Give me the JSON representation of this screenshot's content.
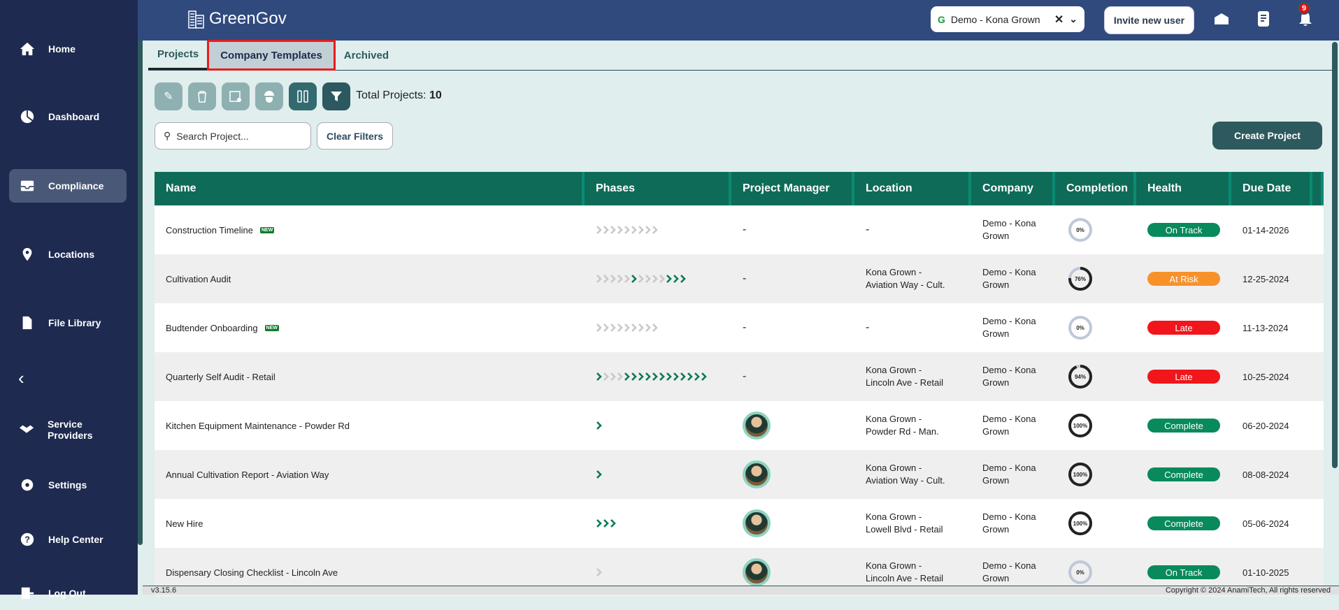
{
  "sidebar": {
    "items": [
      {
        "label": "Home",
        "icon": "home-icon"
      },
      {
        "label": "Dashboard",
        "icon": "pie-chart-icon"
      },
      {
        "label": "Compliance",
        "icon": "inbox-icon",
        "active": true
      },
      {
        "label": "Locations",
        "icon": "location-pin-icon"
      },
      {
        "label": "File Library",
        "icon": "file-icon"
      },
      {
        "label": "Service Providers",
        "icon": "handshake-icon"
      },
      {
        "label": "Settings",
        "icon": "gear-icon"
      },
      {
        "label": "Help Center",
        "icon": "help-icon"
      },
      {
        "label": "Log Out",
        "icon": "logout-icon"
      }
    ]
  },
  "header": {
    "app_name": "GreenGov",
    "company": "Demo - Kona Grown",
    "invite_label": "Invite new user",
    "notification_count": "9"
  },
  "tabs": [
    {
      "label": "Projects"
    },
    {
      "label": "Company Templates"
    },
    {
      "label": "Archived"
    }
  ],
  "toolbar": {
    "total_label": "Total Projects:",
    "total_value": "10"
  },
  "search": {
    "placeholder": "Search Project..."
  },
  "clear_filters": "Clear Filters",
  "create_project": "Create Project",
  "columns": [
    "Name",
    "Phases",
    "Project Manager",
    "Location",
    "Company",
    "Completion",
    "Health",
    "Due Date"
  ],
  "colors": {
    "done": "#0a7a55",
    "pending": "#c8c8c8",
    "On Track": "#088a5c",
    "Complete": "#088a5c",
    "At Risk": "#f7922b",
    "Late": "#f0161b"
  },
  "rows": [
    {
      "name": "Construction Timeline",
      "new": "NEW",
      "phases": "000000000",
      "manager": "-",
      "location": "-",
      "company": "Demo - Kona Grown",
      "completion": 0,
      "completion_label": "0%",
      "health": "On Track",
      "due": "01-14-2026"
    },
    {
      "name": "Cultivation Audit",
      "new": "",
      "phases": "0000010000111",
      "manager": "-",
      "location": "Kona Grown - Aviation Way - Cult.",
      "company": "Demo - Kona Grown",
      "completion": 76,
      "completion_label": "76%",
      "health": "At Risk",
      "due": "12-25-2024"
    },
    {
      "name": "Budtender Onboarding",
      "new": "NEW",
      "phases": "000000000",
      "manager": "-",
      "location": "-",
      "company": "Demo - Kona Grown",
      "completion": 0,
      "completion_label": "0%",
      "health": "Late",
      "due": "11-13-2024"
    },
    {
      "name": "Quarterly Self Audit - Retail",
      "new": "",
      "phases": "1000111111111111",
      "manager": "-",
      "location": "Kona Grown - Lincoln Ave - Retail",
      "company": "Demo - Kona Grown",
      "completion": 94,
      "completion_label": "94%",
      "health": "Late",
      "due": "10-25-2024"
    },
    {
      "name": "Kitchen Equipment Maintenance - Powder Rd",
      "new": "",
      "phases": "1",
      "manager": "avatar",
      "location": "Kona Grown - Powder Rd - Man.",
      "company": "Demo - Kona Grown",
      "completion": 100,
      "completion_label": "100%",
      "health": "Complete",
      "due": "06-20-2024"
    },
    {
      "name": "Annual Cultivation Report - Aviation Way",
      "new": "",
      "phases": "1",
      "manager": "avatar",
      "location": "Kona Grown - Aviation Way - Cult.",
      "company": "Demo - Kona Grown",
      "completion": 100,
      "completion_label": "100%",
      "health": "Complete",
      "due": "08-08-2024"
    },
    {
      "name": "New Hire",
      "new": "",
      "phases": "111",
      "manager": "avatar",
      "location": "Kona Grown - Lowell Blvd - Retail",
      "company": "Demo - Kona Grown",
      "completion": 100,
      "completion_label": "100%",
      "health": "Complete",
      "due": "05-06-2024"
    },
    {
      "name": "Dispensary Closing Checklist - Lincoln Ave",
      "new": "",
      "phases": "0",
      "manager": "avatar",
      "location": "Kona Grown - Lincoln Ave - Retail",
      "company": "Demo - Kona Grown",
      "completion": 0,
      "completion_label": "0%",
      "health": "On Track",
      "due": "01-10-2025"
    }
  ],
  "footer": {
    "version": "v3.15.6",
    "copyright": "Copyright © 2024 AnamiTech, All rights reserved"
  }
}
